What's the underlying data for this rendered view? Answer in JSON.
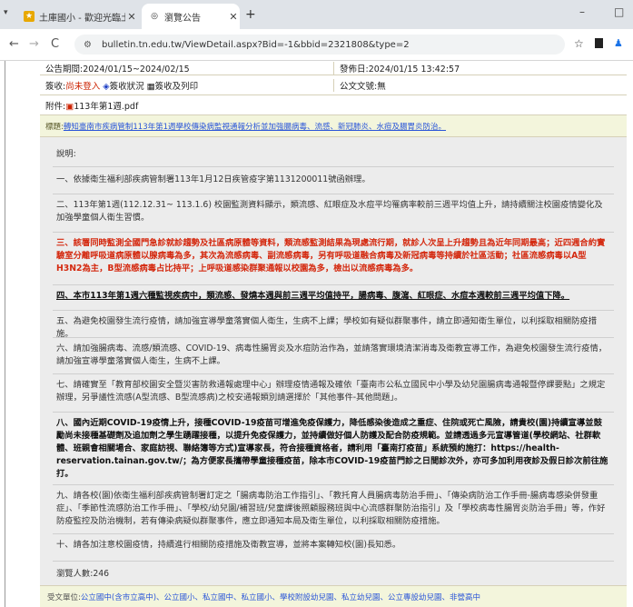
{
  "browser": {
    "tabs": [
      {
        "label": "土庫國小 - 歡迎光臨土庫國小",
        "active": false
      },
      {
        "label": "瀏覽公告",
        "active": true
      }
    ],
    "new_tab": "+",
    "url": "bulletin.tn.edu.tw/ViewDetail.aspx?Bid=-1&bbid=2321808&type=2",
    "window_controls": {
      "minimize": "–",
      "maximize": "□"
    }
  },
  "notice": {
    "period": "公告期間:2024/01/15~2024/02/15",
    "published": "發佈日:2024/01/15 13:42:57",
    "reader_prefix": "簽收:",
    "reader_link": "尚未登入",
    "status_link": "簽收狀況",
    "print_link": "簽收及列印",
    "doc_no": "公文文號:無",
    "attach_label": "附件:",
    "attach_file": "113年第1週.pdf",
    "topic_label": "標題:",
    "topic_text": "轉知臺南市疾病管制113年第1週學校傳染病監視通報分析並加強腸病毒、流感、新冠肺炎、水痘及腸胃炎防治。",
    "desc_label": "說明:",
    "paras": [
      "一、依據衛生福利部疾病管制署113年1月12日疾管疫字第1131200011號函辦理。",
      "二、113年第1週(112.12.31~ 113.1.6) 校園監測資料顯示，類流感、紅眼症及水痘平均罹病率較前三週平均值上升，請持續關注校園疫情變化及加強學童個人衛生習慣。",
      "三、該署同時監測全國門急診就診趨勢及社區病原體等資料，類流感監測結果為現處流行期，就診人次呈上升趨勢且為近年同期最高；近四週合約實驗室分離呼吸道病原體以腺病毒為多，其次為流感病毒、副流感病毒，另有呼吸道融合病毒及新冠病毒等持續於社區活動；社區流感病毒以A型H3N2為主，B型流感病毒占比持平；上呼吸道感染群聚通報以校園為多，檢出以流感病毒為多。",
      "四、本市113年第1週六種監視疾病中，類流感、發燒本週與前三週平均值持平，腸病毒、腹瀉、紅眼症、水痘本週較前三週平均值下降。",
      "五、為避免校園發生流行疫情，請加強宣導學童落實個人衛生，生病不上課；學校如有疑似群聚事件，請立即通知衛生單位，以利採取相關防疫措施。",
      "六、請加強腸病毒、流感/類流感、COVID-19、病毒性腸胃炎及水痘防治作為，並請落實環境清潔消毒及衛教宣導工作，為避免校園發生流行疫情，請加強宣導學童落實個人衛生，生病不上課。",
      "七、請確實至「教育部校園安全暨災害防救通報處理中心」辦理疫情通報及確依「臺南市公私立國民中小學及幼兒園腸病毒通報暨停課要點」之規定辦理，另爭議性流感(A型流感、B型流感病)之校安通報類別請選擇於「其他事件-其他問題」。",
      "八、國內近期COVID-19疫情上升，接種COVID-19疫苗可增進免疫保護力，降低感染後造成之重症、住院或死亡風險，請貴校(園)持續宣導並鼓勵尚未接種基礎劑及追加劑之學生踴躍接種，以提升免疫保護力，並持續做好個人防護及配合防疫規範。並請透過多元宣導管道(學校網站、社群軟體、班親會相關場合、家庭訪視、聯絡簿等方式)宣導家長，符合接種資格者，請利用「臺南打疫苗」系統預約施打：https://health-reservation.tainan.gov.tw/；為方便家長攜帶學童接種疫苗，除本市COVID-19疫苗門診之日間診次外，亦可多加利用夜診及假日診次前往施打。",
      "九、請各校(園)依衛生福利部疾病管制署訂定之「腸病毒防治工作指引」、「教托育人員腸病毒防治手冊」、「傳染病防治工作手冊-腸病毒感染併發重症」、「季節性流感防治工作手冊」、「學校/幼兒園/補習班/兒童課後照顧服務班與中心流感群聚防治指引」及「學校病毒性腸胃炎防治手冊」等，作好防疫監控及防治機制，若有傳染病疑似群聚事件，應立即通知本局及衛生單位，以利採取相關防疫措施。",
      "十、請各加注意校園疫情，持續進行相關防疫措施及衛教宣導，並將本案轉知校(園)長知悉。"
    ],
    "views": "瀏覽人數:246",
    "audience_label": "受文單位:",
    "audience": "公立國中(含市立高中)、公立國小、私立國中、私立國小、學校附設幼兒園、私立幼兒園、公立專設幼兒園、非營高中"
  }
}
